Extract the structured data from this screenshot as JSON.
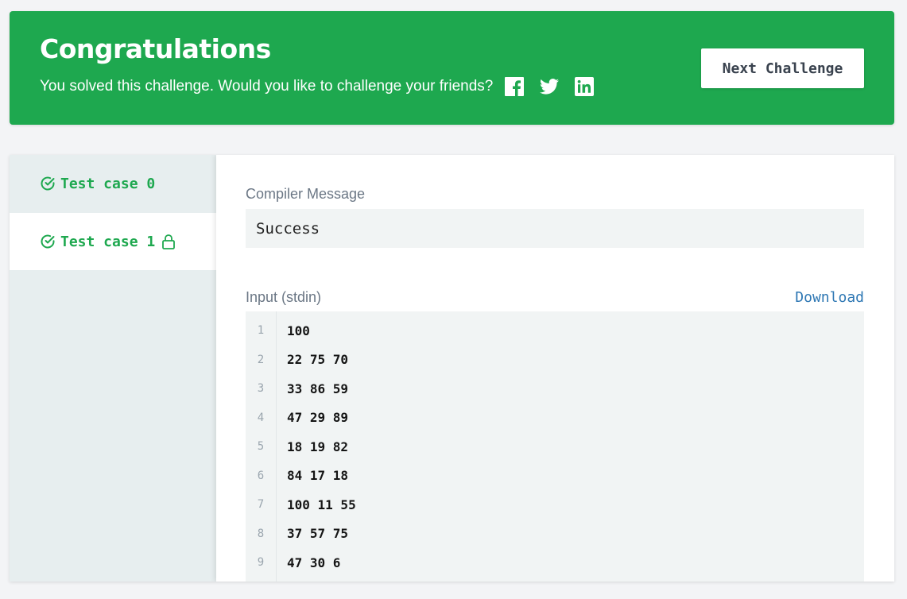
{
  "banner": {
    "title": "Congratulations",
    "subtitle": "You solved this challenge. Would you like to challenge your friends?",
    "social_icons": [
      "facebook-icon",
      "twitter-icon",
      "linkedin-icon"
    ],
    "next_button": "Next Challenge",
    "color": "#1ea84f"
  },
  "tabs": [
    {
      "label": "Test case 0",
      "status": "passed",
      "locked": false,
      "selected": false
    },
    {
      "label": "Test case 1",
      "status": "passed",
      "locked": true,
      "selected": true
    }
  ],
  "result": {
    "compiler_label": "Compiler Message",
    "compiler_message": "Success",
    "input_label": "Input (stdin)",
    "download_label": "Download",
    "input_lines": [
      {
        "n": "1",
        "text": "100"
      },
      {
        "n": "2",
        "text": "22 75 70"
      },
      {
        "n": "3",
        "text": "33 86 59"
      },
      {
        "n": "4",
        "text": "47 29 89"
      },
      {
        "n": "5",
        "text": "18 19 82"
      },
      {
        "n": "6",
        "text": "84 17 18"
      },
      {
        "n": "7",
        "text": "100 11 55"
      },
      {
        "n": "8",
        "text": "37 57 75"
      },
      {
        "n": "9",
        "text": "47 30 6"
      }
    ]
  },
  "colors": {
    "accent": "#1ea84f",
    "link": "#2f78b4",
    "panel_bg": "#e7eeef",
    "code_bg": "#f1f4f4"
  }
}
